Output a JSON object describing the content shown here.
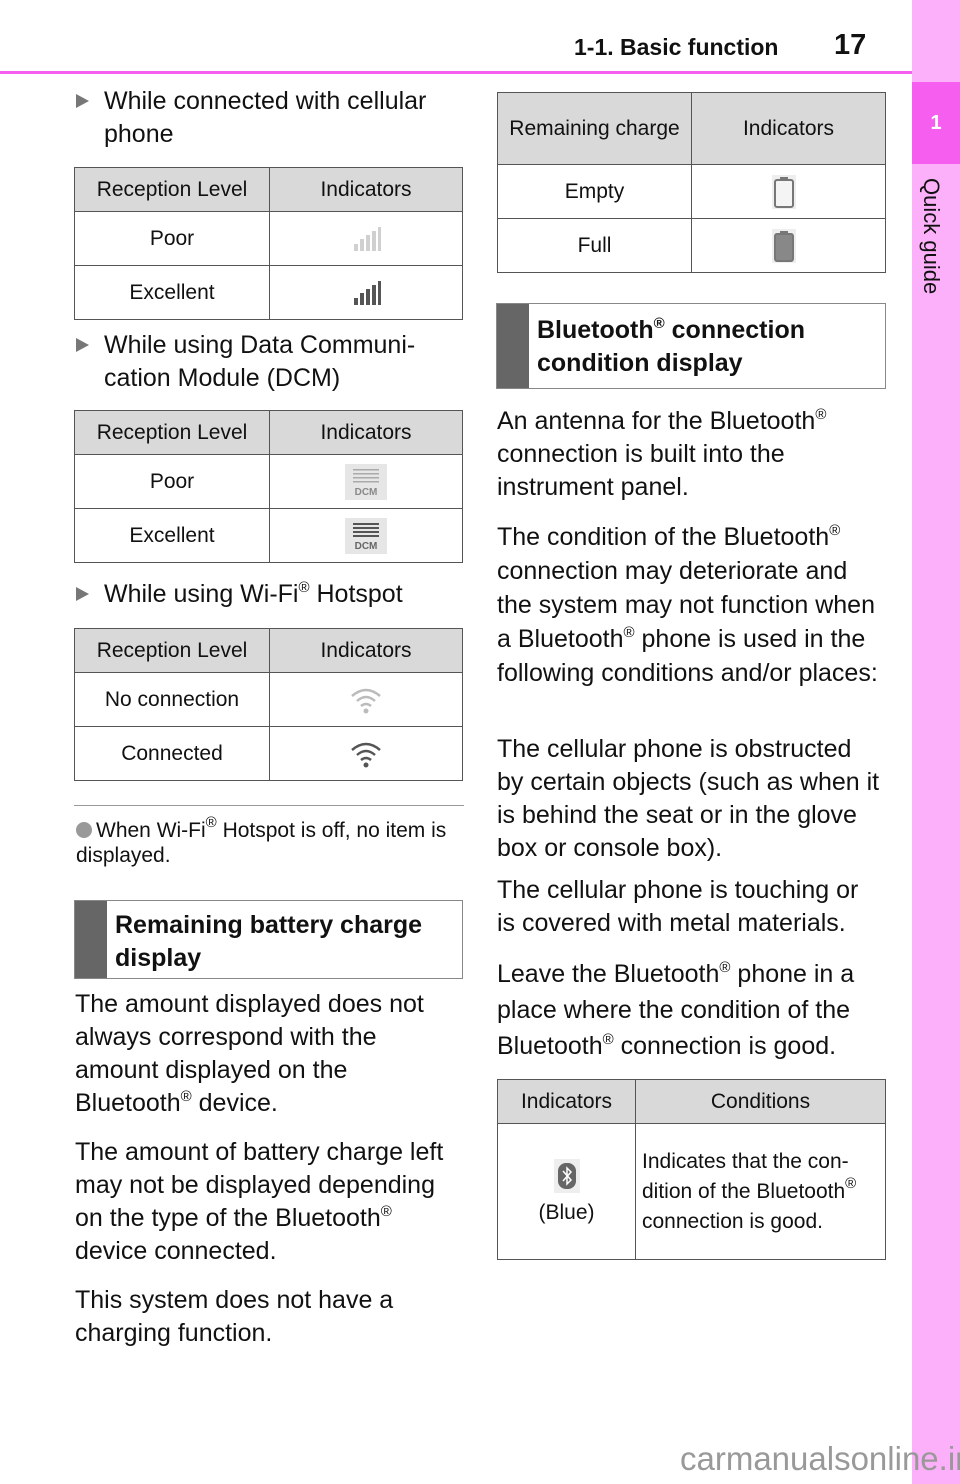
{
  "header": {
    "section_title": "1-1. Basic function",
    "page_number": "17",
    "accent_color": "#f65ef0"
  },
  "side_tab": {
    "chapter_number": "1",
    "chapter_label": "Quick guide"
  },
  "left_column": {
    "cellular": {
      "heading": "While connected with cellular phone",
      "table": {
        "headers": [
          "Reception Level",
          "Indicators"
        ],
        "rows": [
          {
            "level": "Poor",
            "icon": "signal-bars-poor-icon"
          },
          {
            "level": "Excellent",
            "icon": "signal-bars-excellent-icon"
          }
        ]
      }
    },
    "dcm": {
      "heading": "While using Data Communi-cation Module (DCM)",
      "heading_line1": "While using Data Communi-",
      "heading_line2": "cation Module (DCM)",
      "icon_label": "DCM",
      "table": {
        "headers": [
          "Reception Level",
          "Indicators"
        ],
        "rows": [
          {
            "level": "Poor",
            "icon": "dcm-poor-icon"
          },
          {
            "level": "Excellent",
            "icon": "dcm-excellent-icon"
          }
        ]
      }
    },
    "wifi": {
      "heading_pre": "While using Wi-Fi",
      "heading_post": " Hotspot",
      "table": {
        "headers": [
          "Reception Level",
          "Indicators"
        ],
        "rows": [
          {
            "level": "No connection",
            "icon": "wifi-off-icon"
          },
          {
            "level": "Connected",
            "icon": "wifi-connected-icon"
          }
        ]
      }
    },
    "note": {
      "pre": "When Wi-Fi",
      "post": " Hotspot is off, no item is displayed."
    },
    "battery_section": {
      "title_line1": "Remaining battery charge",
      "title_line2": "display"
    },
    "battery_paragraphs": {
      "p1_pre": "The amount displayed does not always correspond with the amount displayed on the Bluetooth",
      "p1_post": " device.",
      "p2_pre": "The amount of battery charge left may not be displayed depending on the type of the Bluetooth",
      "p2_post": " device connected.",
      "p3": "This system does not have a charging function."
    }
  },
  "right_column": {
    "battery_table": {
      "headers": [
        "Remaining charge",
        "Indicators"
      ],
      "rows": [
        {
          "charge": "Empty",
          "icon": "battery-empty-icon"
        },
        {
          "charge": "Full",
          "icon": "battery-full-icon"
        }
      ]
    },
    "bluetooth_section": {
      "title_pre": "Bluetooth",
      "title_post": " connection",
      "title_line2": "condition display"
    },
    "paragraphs": {
      "p1_pre": "An antenna for the Bluetooth",
      "p1_post": " connection is built into the instrument panel.",
      "p2_a": "The condition of the Bluetooth",
      "p2_b": " connection may deteriorate and the system may not function when a Bluetooth",
      "p2_c": " phone is used in the following conditions and/or places:",
      "p3": "The cellular phone is obstructed by certain objects (such as when it is behind the seat or in the glove box or console box).",
      "p4": "The cellular phone is touching or is covered with metal materials.",
      "p5_a": "Leave the Bluetooth",
      "p5_b": " phone in a place where the condition of the Bluetooth",
      "p5_c": " connection is good."
    },
    "bluetooth_table": {
      "headers": [
        "Indicators",
        "Conditions"
      ],
      "rows": [
        {
          "icon": "bluetooth-icon",
          "icon_caption": "(Blue)",
          "condition_pre": "Indicates that the con-dition of the Bluetooth",
          "condition_post": " connection is good."
        }
      ]
    }
  },
  "registered_mark": "®",
  "watermark": "carmanualsonline.info"
}
